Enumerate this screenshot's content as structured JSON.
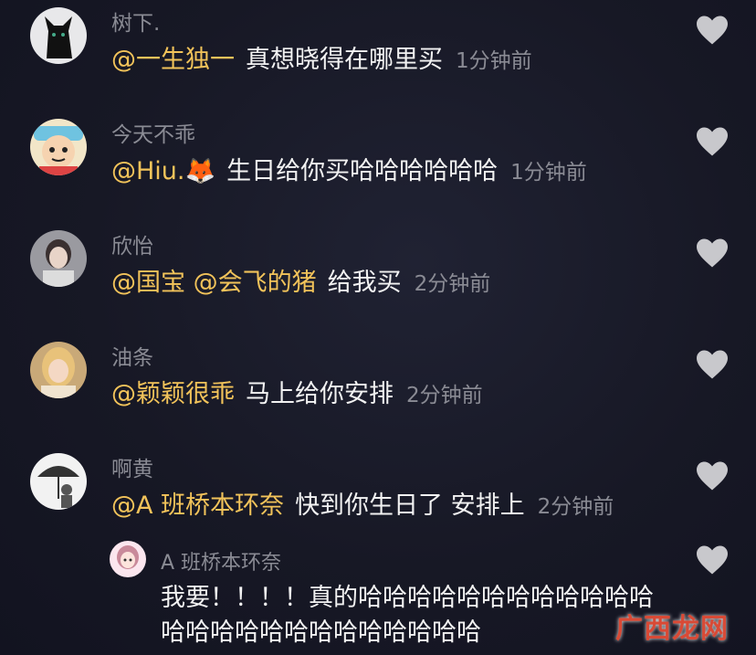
{
  "comments": [
    {
      "username": "树下.",
      "mention": "@一生独一",
      "text": "真想晓得在哪里买",
      "time": "1分钟前",
      "avatar": "black-cat-avatar"
    },
    {
      "username": "今天不乖",
      "mention": "@Hiu.🦊",
      "text": "生日给你买哈哈哈哈哈哈",
      "time": "1分钟前",
      "avatar": "cartoon-boy-avatar"
    },
    {
      "username": "欣怡",
      "mention": "@国宝 @会飞的猪",
      "text": "给我买",
      "time": "2分钟前",
      "avatar": "girl-photo-avatar"
    },
    {
      "username": "油条",
      "mention": "@颖颖很乖",
      "text": "马上给你安排",
      "time": "2分钟前",
      "avatar": "blonde-girl-avatar"
    },
    {
      "username": "啊黄",
      "mention": "@A 班桥本环奈",
      "text": "快到你生日了 安排上",
      "time": "2分钟前",
      "avatar": "umbrella-avatar"
    }
  ],
  "reply": {
    "username": "A 班桥本环奈",
    "text": "我要！！！！真的哈哈哈哈哈哈哈哈哈哈哈哈哈哈哈哈哈哈哈哈哈哈哈哈哈",
    "avatar": "anime-girl-avatar"
  },
  "watermark": "广西龙网",
  "colors": {
    "background": "#161823",
    "mention": "#f2c35a",
    "muted": "#8a8b94",
    "like_icon": "#c8c8cc"
  }
}
